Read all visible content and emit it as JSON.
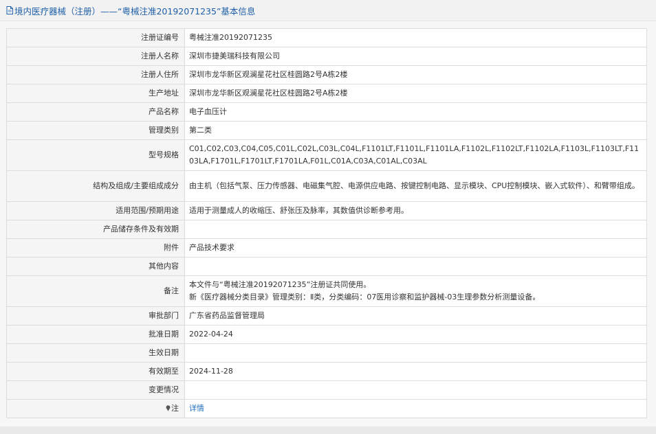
{
  "page_title": "境内医疗器械（注册）——“粤械注准20192071235”基本信息",
  "rows": [
    {
      "label": "注册证编号",
      "value": "粤械注准20192071235"
    },
    {
      "label": "注册人名称",
      "value": "深圳市捷美瑞科技有限公司"
    },
    {
      "label": "注册人住所",
      "value": "深圳市龙华新区观澜星花社区桂圆路2号A栋2楼"
    },
    {
      "label": "生产地址",
      "value": "深圳市龙华新区观澜星花社区桂圆路2号A栋2楼"
    },
    {
      "label": "产品名称",
      "value": "电子血压计"
    },
    {
      "label": "管理类别",
      "value": "第二类"
    },
    {
      "label": "型号规格",
      "value": "C01,C02,C03,C04,C05,C01L,C02L,C03L,C04L,F1101LT,F1101L,F1101LA,F1102L,F1102LT,F1102LA,F1103L,F1103LT,F1103LA,F1701L,F1701LT,F1701LA,F01L,C01A,C03A,C01AL,C03AL"
    },
    {
      "label": "结构及组成/主要组成成分",
      "value": "由主机（包括气泵、压力传感器、电磁集气腔、电源供应电路、按键控制电路、显示模块、CPU控制模块、嵌入式软件）、和臂带组成。"
    },
    {
      "label": "适用范围/预期用途",
      "value": "适用于测量成人的收缩压、舒张压及脉率，其数值供诊断参考用。"
    },
    {
      "label": "产品储存条件及有效期",
      "value": ""
    },
    {
      "label": "附件",
      "value": "产品技术要求"
    },
    {
      "label": "其他内容",
      "value": ""
    },
    {
      "label": "备注",
      "value_line1": "本文件与“粤械注准20192071235”注册证共同使用。",
      "value_line2": "新《医疗器械分类目录》管理类别：Ⅱ类，分类编码：07医用诊察和监护器械-03生理参数分析测量设备。"
    },
    {
      "label": "审批部门",
      "value": "广东省药品监督管理局"
    },
    {
      "label": "批准日期",
      "value": "2022-04-24"
    },
    {
      "label": "生效日期",
      "value": ""
    },
    {
      "label": "有效期至",
      "value": "2024-11-28"
    },
    {
      "label": "变更情况",
      "value": ""
    },
    {
      "label": "注",
      "value": "详情"
    }
  ]
}
